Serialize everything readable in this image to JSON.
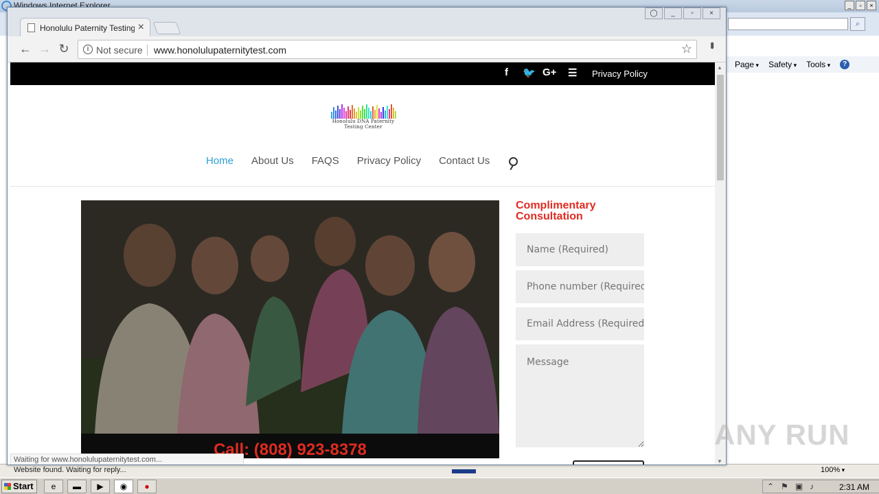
{
  "ie": {
    "title": "Windows Internet Explorer",
    "commands": [
      "Page",
      "Safety",
      "Tools"
    ],
    "status": "Website found. Waiting for reply...",
    "zoom": "100%"
  },
  "chrome": {
    "tab_title": "Honolulu Paternity Testing |",
    "security_label": "Not secure",
    "url": "www.honolulupaternitytest.com",
    "status": "Waiting for www.honolulupaternitytest.com..."
  },
  "site": {
    "top_privacy": "Privacy Policy",
    "logo_line1": "Honolulu DNA Paternity",
    "logo_line2": "Testing Center",
    "nav": [
      "Home",
      "About Us",
      "FAQS",
      "Privacy Policy",
      "Contact Us"
    ],
    "call": "Call: (808) 923-8378",
    "consult_title": "Complimentary Consultation",
    "form": {
      "name_ph": "Name (Required)",
      "phone_ph": "Phone number (Required)",
      "email_ph": "Email Address (Required)",
      "message_ph": "Message"
    }
  },
  "taskbar": {
    "start": "Start",
    "clock": "2:31 AM"
  },
  "watermark": "ANY RUN",
  "colors": {
    "accent_red": "#e02b20",
    "nav_active": "#2e9fd3"
  }
}
